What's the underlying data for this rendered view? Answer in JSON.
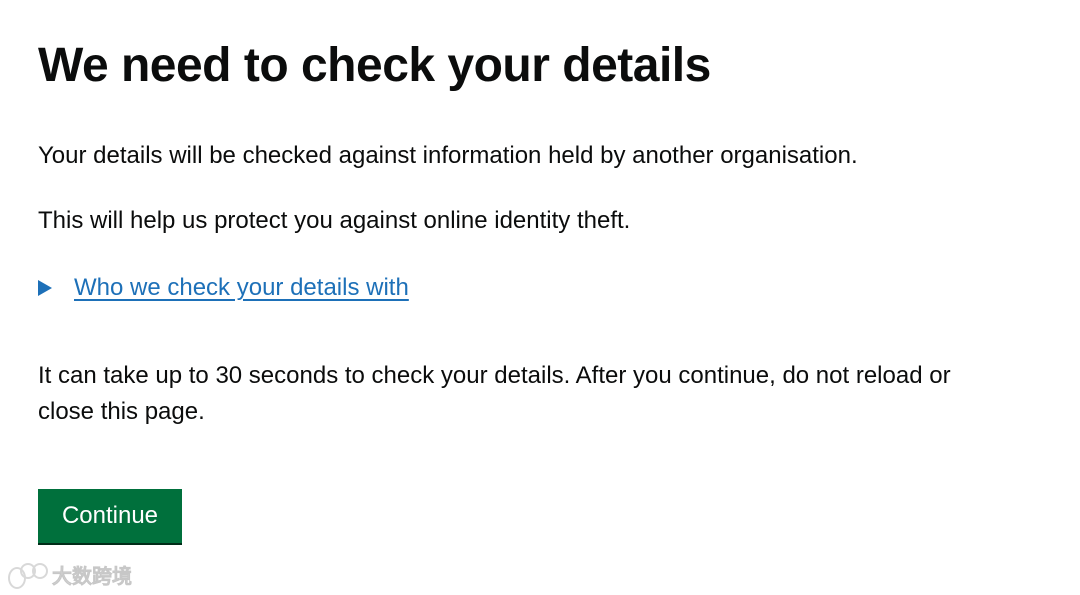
{
  "heading": "We need to check your details",
  "paragraphs": {
    "checked_against": "Your details will be checked against information held by another organisation.",
    "protect": "This will help us protect you against online identity theft.",
    "wait_notice": "It can take up to 30 seconds to check your details. After you continue, do not reload or close this page."
  },
  "details": {
    "summary_label": "Who we check your details with"
  },
  "actions": {
    "continue_label": "Continue"
  },
  "watermark": {
    "text": "大数跨境"
  },
  "colors": {
    "text": "#0b0c0c",
    "link": "#1d70b8",
    "button": "#00703c",
    "button_shadow": "#002d18",
    "background": "#ffffff"
  },
  "icons": {
    "details_toggle": "triangle-right-icon"
  }
}
